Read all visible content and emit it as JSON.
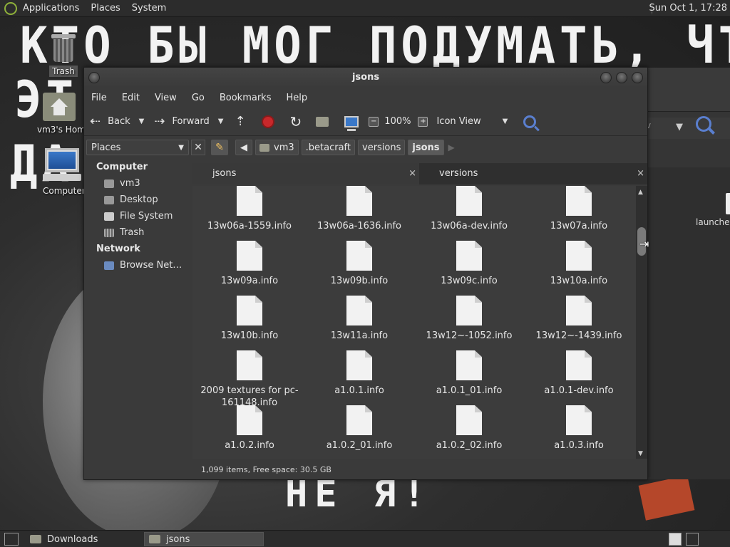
{
  "top_panel": {
    "menus": [
      "Applications",
      "Places",
      "System"
    ],
    "clock": "Sun Oct  1, 17:28"
  },
  "wallpaper": {
    "line1": "КТО БЫ МОГ ПОДУМАТЬ, ЧТО Я -",
    "line1_left": "ЭТ",
    "line2_left": "ДА",
    "line3": "НЕ Я!"
  },
  "desktop_icons": {
    "trash": "Trash",
    "home": "vm3's Home",
    "computer": "Computer"
  },
  "bg_window": {
    "view_fragment": "v",
    "file_label": "launcher"
  },
  "window": {
    "title": "jsons",
    "menu": [
      "File",
      "Edit",
      "View",
      "Go",
      "Bookmarks",
      "Help"
    ],
    "toolbar": {
      "back": "Back",
      "forward": "Forward",
      "zoom": "100%",
      "view_mode": "Icon View"
    },
    "location": {
      "places_label": "Places",
      "crumbs": [
        "vm3",
        ".betacraft",
        "versions",
        "jsons"
      ]
    },
    "sidebar": {
      "computer_header": "Computer",
      "computer_items": [
        "vm3",
        "Desktop",
        "File System",
        "Trash"
      ],
      "network_header": "Network",
      "network_items": [
        "Browse Net…"
      ]
    },
    "tabs": [
      {
        "label": "jsons",
        "close": "×"
      },
      {
        "label": "versions",
        "close": "×"
      }
    ],
    "files": [
      [
        "13w06a-1559.info",
        "13w06a-1636.info",
        "13w06a-dev.info",
        "13w07a.info"
      ],
      [
        "13w09a.info",
        "13w09b.info",
        "13w09c.info",
        "13w10a.info"
      ],
      [
        "13w10b.info",
        "13w11a.info",
        "13w12~-1052.info",
        "13w12~-1439.info"
      ],
      [
        "2009 textures for pc-161148.info",
        "a1.0.1.info",
        "a1.0.1_01.info",
        "a1.0.1-dev.info"
      ],
      [
        "a1.0.2.info",
        "a1.0.2_01.info",
        "a1.0.2_02.info",
        "a1.0.3.info"
      ]
    ],
    "status": "1,099 items, Free space: 30.5 GB"
  },
  "taskbar": {
    "items": [
      "Downloads",
      "jsons"
    ]
  }
}
